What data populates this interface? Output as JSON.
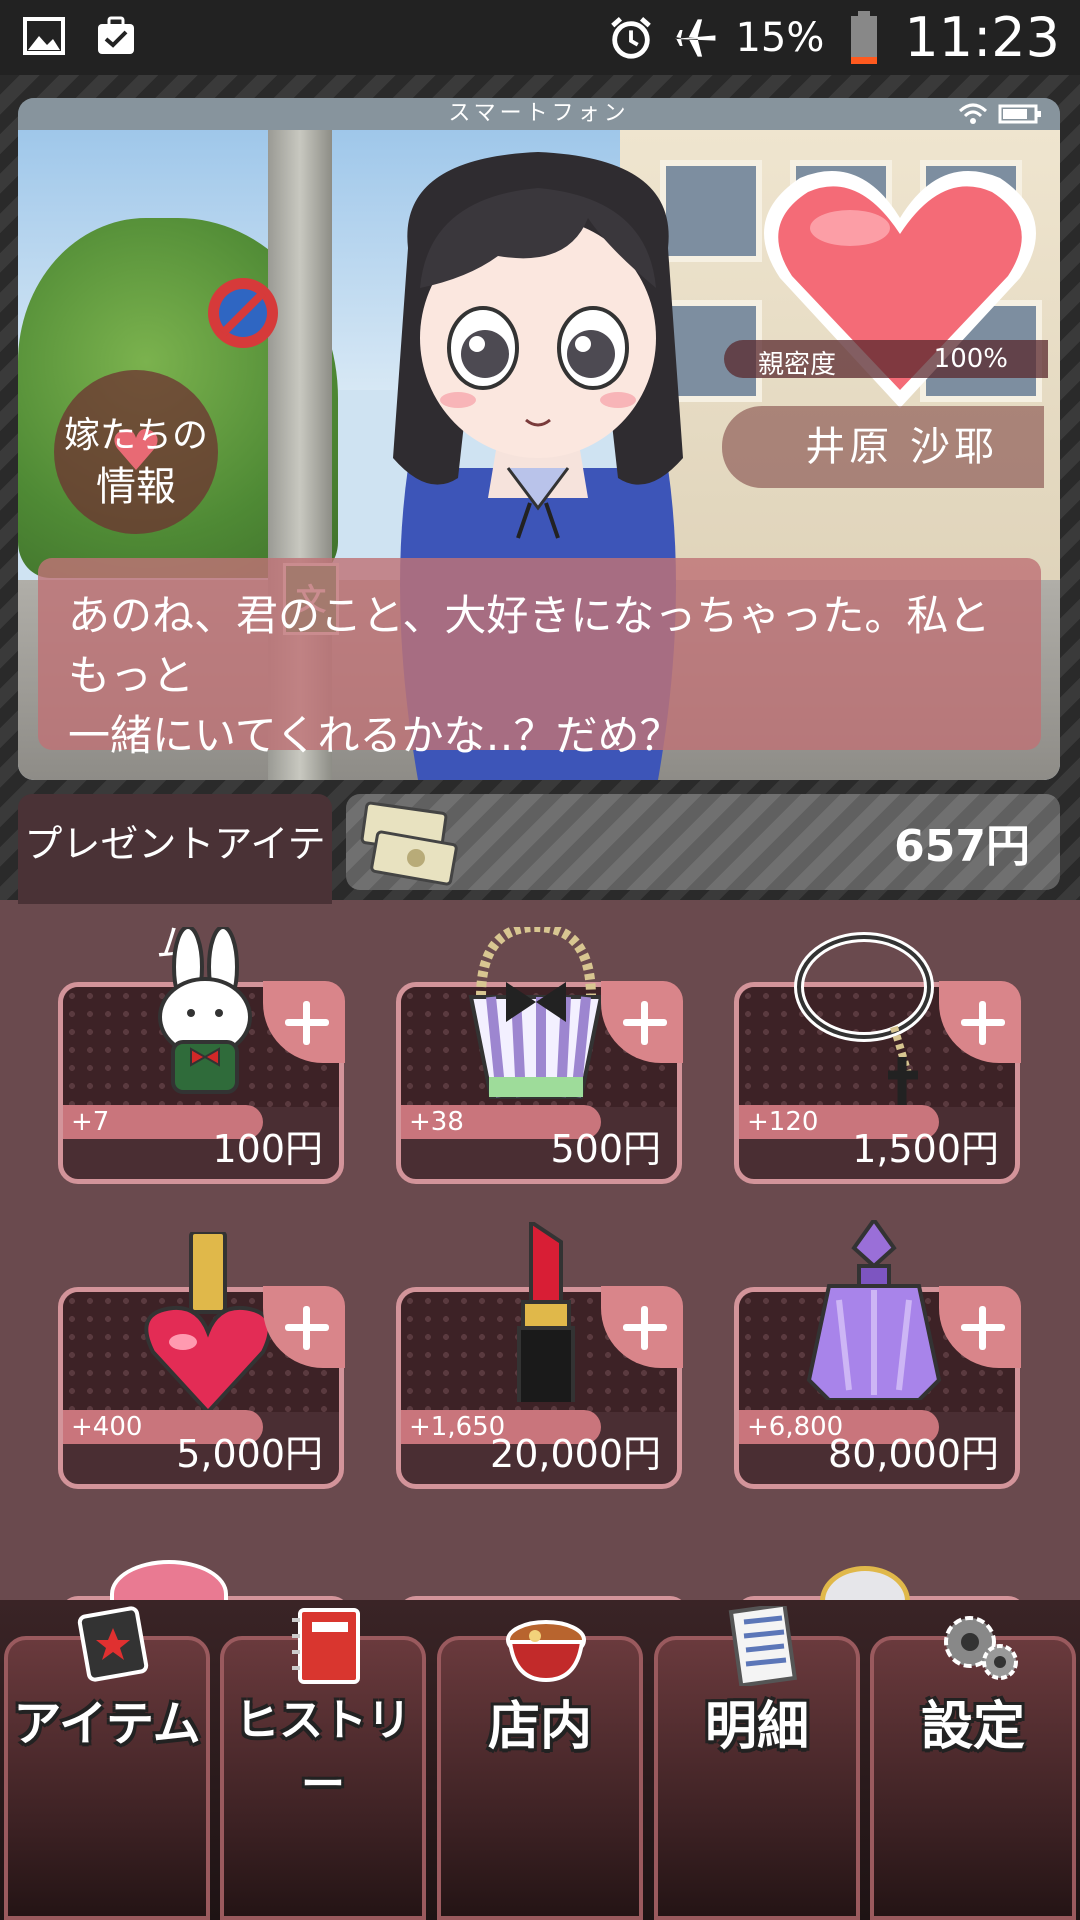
{
  "status_bar": {
    "battery": "15%",
    "time": "11:23"
  },
  "phone": {
    "title": "スマートフォン",
    "info_badge": {
      "line1": "嫁たちの",
      "line2": "情報"
    },
    "affinity": {
      "label": "親密度",
      "value": "100%"
    },
    "character_name": "井原 沙耶",
    "dialog": [
      "あのね、君のこと、大好きになっちゃった。私ともっと",
      "一緒にいてくれるかな‥？だめ？"
    ]
  },
  "present": {
    "tab_label": "プレゼントアイテム",
    "money": "657円"
  },
  "items": [
    {
      "icon": "bunny-plush-icon",
      "bonus": "+7",
      "price": "100円"
    },
    {
      "icon": "handbag-icon",
      "bonus": "+38",
      "price": "500円"
    },
    {
      "icon": "rosary-necklace-icon",
      "bonus": "+120",
      "price": "1,500円"
    },
    {
      "icon": "nail-polish-icon",
      "bonus": "+400",
      "price": "5,000円"
    },
    {
      "icon": "lipstick-icon",
      "bonus": "+1,650",
      "price": "20,000円"
    },
    {
      "icon": "perfume-bottle-icon",
      "bonus": "+6,800",
      "price": "80,000円"
    }
  ],
  "nav": [
    {
      "label": "アイテム",
      "icon": "item-card-icon"
    },
    {
      "label": "ヒストリー",
      "icon": "notebook-icon"
    },
    {
      "label": "店内",
      "icon": "food-bowl-icon"
    },
    {
      "label": "明細",
      "icon": "receipt-icon"
    },
    {
      "label": "設定",
      "icon": "gears-icon"
    }
  ],
  "colors": {
    "accent_pink": "#d9858a",
    "card_border": "#d3949a",
    "background": "#6a4a4e"
  }
}
